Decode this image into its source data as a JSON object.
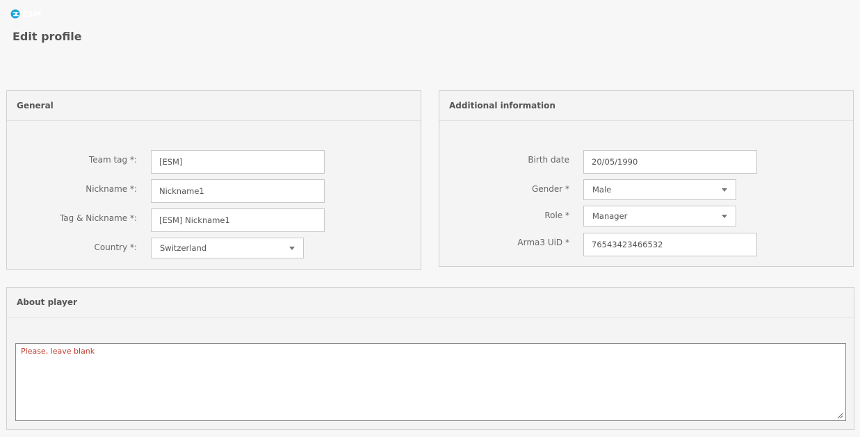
{
  "page": {
    "logo_text": "ESM",
    "title": "Edit profile"
  },
  "colors": {
    "logo_accent": "#1aa3d9",
    "placeholder_red": "#c0392b"
  },
  "general": {
    "heading": "General",
    "team_tag_label": "Team tag *:",
    "team_tag_value": "[ESM]",
    "nickname_label": "Nickname *:",
    "nickname_value": "Nickname1",
    "tag_nickname_label": "Tag & Nickname *:",
    "tag_nickname_value": "[ESM] Nickname1",
    "country_label": "Country *:",
    "country_value": "Switzerland"
  },
  "additional": {
    "heading": "Additional information",
    "birth_date_label": "Birth date",
    "birth_date_value": "20/05/1990",
    "gender_label": "Gender *",
    "gender_value": "Male",
    "role_label": "Role *",
    "role_value": "Manager",
    "uid_label": "Arma3 UiD *",
    "uid_value": "76543423466532"
  },
  "about": {
    "heading": "About player",
    "placeholder": "Please, leave blank"
  }
}
